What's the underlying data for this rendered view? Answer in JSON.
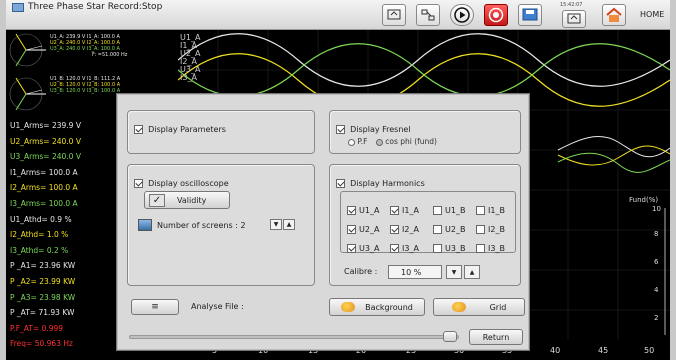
{
  "titlebar": {
    "title": "Three Phase Star Record:Stop",
    "clock": "15:42:07",
    "home_label": "HOME",
    "icons": [
      "screen-icon",
      "network-icon",
      "play-icon",
      "record-icon",
      "save-icon",
      "screen-icon",
      "home-icon"
    ]
  },
  "phasor_values": {
    "group1": [
      "U1_A: 239.9 V   I1_A: 100.0 A",
      "U2_A: 240.0 V   I2_A: 100.0 A",
      "U3_A: 240.0 V   I3_A: 100.0 A",
      "F: =51.000 Hz"
    ],
    "group2": [
      "U1_B: 120.0 V   I1_B: 111.2 A",
      "U2_B: 120.0 V   I2_B: 100.0 A",
      "U3_B: 120.0 V   I3_B: 100.0 A"
    ]
  },
  "wave_labels": [
    "U1_A",
    "I1_A",
    "U2_A",
    "I2_A",
    "U3_A",
    "I3_A"
  ],
  "measurements": [
    {
      "text": "U1_Arms= 239.9 V",
      "color": "#e8e8e8"
    },
    {
      "text": "U2_Arms= 240.0 V",
      "color": "#f0e020"
    },
    {
      "text": "U3_Arms= 240.0 V",
      "color": "#7ed957"
    },
    {
      "text": "I1_Arms= 100.0 A",
      "color": "#e8e8e8"
    },
    {
      "text": "I2_Arms= 100.0 A",
      "color": "#f0e020"
    },
    {
      "text": "I3_Arms= 100.0 A",
      "color": "#7ed957"
    },
    {
      "text": "U1_Athd= 0.9 %",
      "color": "#e8e8e8"
    },
    {
      "text": "I2_Athd= 1.0 %",
      "color": "#f0e020"
    },
    {
      "text": "I3_Athd= 0.2 %",
      "color": "#7ed957"
    },
    {
      "text": "P _A1= 23.96 KW",
      "color": "#e8e8e8"
    },
    {
      "text": "P _A2= 23.99 KW",
      "color": "#f0e020"
    },
    {
      "text": "P _A3= 23.98 KW",
      "color": "#7ed957"
    },
    {
      "text": "P _AT= 71.93 KW",
      "color": "#e8e8e8"
    },
    {
      "text": "P.F_AT= 0.999",
      "color": "#ff3030"
    },
    {
      "text": "Freq= 50.963 Hz",
      "color": "#ff3030"
    }
  ],
  "x_axis_ticks": [
    "5",
    "10",
    "15",
    "20",
    "25",
    "30",
    "35",
    "40",
    "45",
    "50"
  ],
  "y_axis": {
    "label": "Fund(%)",
    "ticks": [
      "10",
      "8",
      "6",
      "4",
      "2"
    ]
  },
  "dialog": {
    "display_parameters": {
      "label": "Display Parameters",
      "checked": true
    },
    "display_fresnel": {
      "label": "Display Fresnel",
      "checked": true,
      "options": [
        "P.F",
        "cos phi (fund)"
      ],
      "selected": "cos phi (fund)"
    },
    "display_oscilloscope": {
      "label": "Display oscilloscope",
      "checked": true
    },
    "validity_label": "Validity",
    "screens_label": "Number of screens : 2",
    "display_harmonics": {
      "label": "Display Harmonics",
      "checked": true
    },
    "harmonics": [
      [
        {
          "label": "U1_A",
          "checked": true
        },
        {
          "label": "I1_A",
          "checked": true
        },
        {
          "label": "U1_B",
          "checked": false
        },
        {
          "label": "I1_B",
          "checked": false
        }
      ],
      [
        {
          "label": "U2_A",
          "checked": true
        },
        {
          "label": "I2_A",
          "checked": true
        },
        {
          "label": "U2_B",
          "checked": false
        },
        {
          "label": "I2_B",
          "checked": false
        }
      ],
      [
        {
          "label": "U3_A",
          "checked": true
        },
        {
          "label": "I3_A",
          "checked": true
        },
        {
          "label": "U3_B",
          "checked": false
        },
        {
          "label": "I3_B",
          "checked": false
        }
      ]
    ],
    "calibre_label": "Calibre :",
    "calibre_value": "10 %",
    "analyse_label": "Analyse File :",
    "background_label": "Background",
    "grid_label": "Grid",
    "return_label": "Return"
  }
}
